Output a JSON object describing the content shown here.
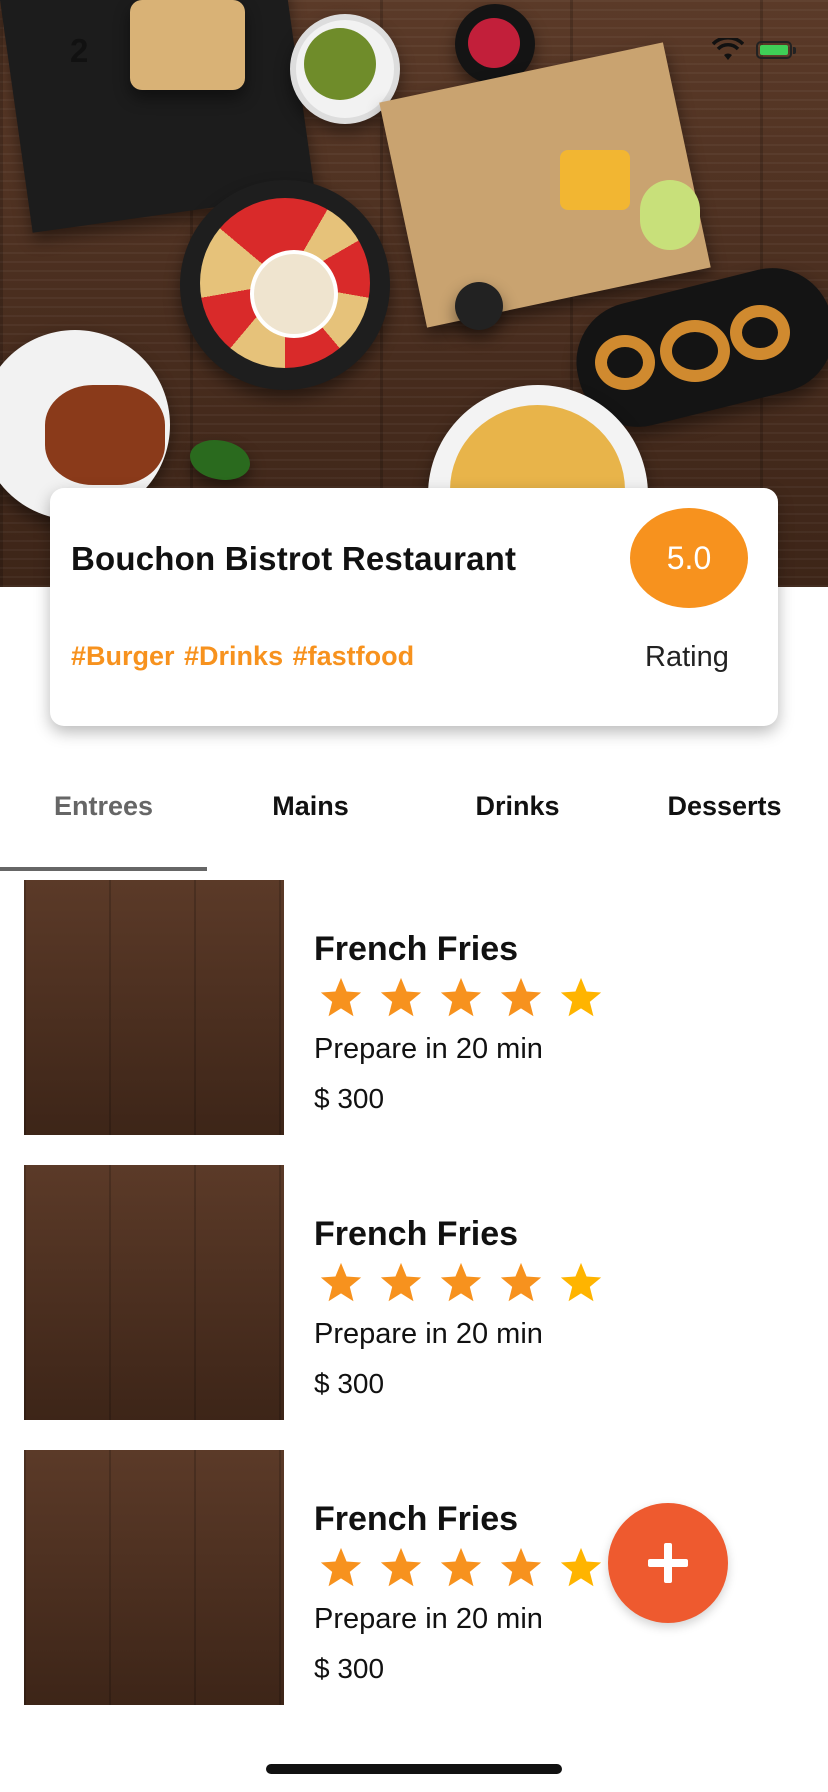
{
  "status_bar": {
    "time": "2"
  },
  "restaurant": {
    "name": "Bouchon Bistrot Restaurant",
    "rating": "5.0",
    "rating_label": "Rating",
    "tags": "#Burger #Drinks #fastfood"
  },
  "tabs": [
    {
      "label": "Entrees",
      "active": true
    },
    {
      "label": "Mains",
      "active": false
    },
    {
      "label": "Drinks",
      "active": false
    },
    {
      "label": "Desserts",
      "active": false
    }
  ],
  "items": [
    {
      "title": "French Fries",
      "stars": 5,
      "prep": "Prepare in 20 min",
      "price": "$ 300"
    },
    {
      "title": "French Fries",
      "stars": 5,
      "prep": "Prepare in 20 min",
      "price": "$ 300"
    },
    {
      "title": "French Fries",
      "stars": 5,
      "prep": "Prepare in 20 min",
      "price": "$ 300"
    }
  ],
  "colors": {
    "accent": "#f7921e",
    "fab": "#ee5a2f",
    "star": "#f7921e",
    "star_last": "#ffb400"
  },
  "icons": {
    "fab": "plus-icon",
    "star": "star-icon",
    "wifi": "wifi-icon",
    "battery": "battery-icon"
  }
}
